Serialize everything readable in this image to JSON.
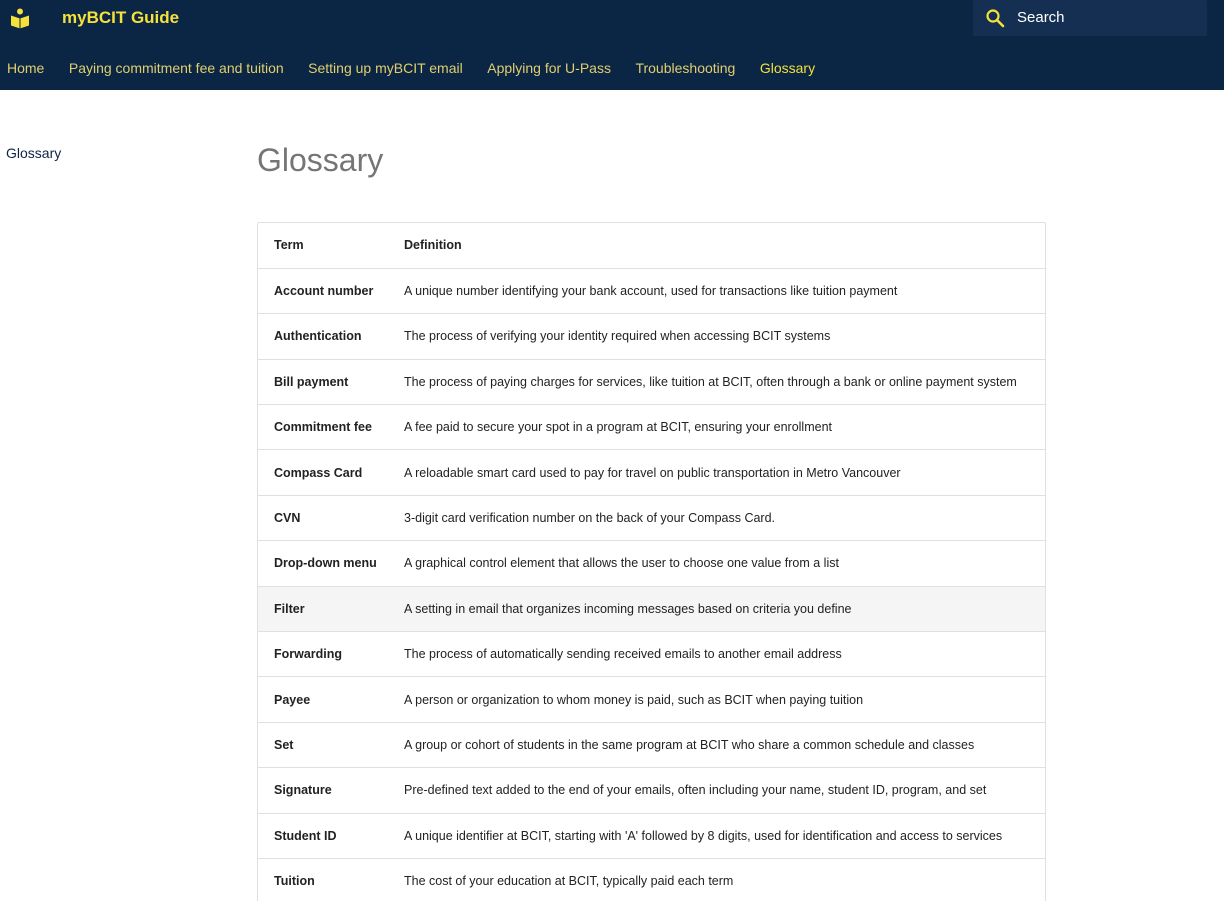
{
  "header": {
    "site_title": "myBCIT Guide",
    "logo_icon": "book-person-icon",
    "search_placeholder": "Search",
    "colors": {
      "background": "#0b2544",
      "accent": "#f5e13c"
    }
  },
  "tabs": [
    {
      "label": "Home",
      "active": false
    },
    {
      "label": "Paying commitment fee and tuition",
      "active": false
    },
    {
      "label": "Setting up myBCIT email",
      "active": false
    },
    {
      "label": "Applying for U-Pass",
      "active": false
    },
    {
      "label": "Troubleshooting",
      "active": false
    },
    {
      "label": "Glossary",
      "active": true
    }
  ],
  "sidebar": {
    "link": "Glossary"
  },
  "main": {
    "title": "Glossary",
    "table": {
      "headers": [
        "Term",
        "Definition"
      ],
      "rows": [
        {
          "term": "Account number",
          "definition": "A unique number identifying your bank account, used for transactions like tuition payment"
        },
        {
          "term": "Authentication",
          "definition": "The process of verifying your identity required when accessing BCIT systems"
        },
        {
          "term": "Bill payment",
          "definition": "The process of paying charges for services, like tuition at BCIT, often through a bank or online payment system"
        },
        {
          "term": "Commitment fee",
          "definition": "A fee paid to secure your spot in a program at BCIT, ensuring your enrollment"
        },
        {
          "term": "Compass Card",
          "definition": "A reloadable smart card used to pay for travel on public transportation in Metro Vancouver"
        },
        {
          "term": "CVN",
          "definition": "3-digit card verification number on the back of your Compass Card."
        },
        {
          "term": "Drop-down menu",
          "definition": "A graphical control element that allows the user to choose one value from a list"
        },
        {
          "term": "Filter",
          "definition": "A setting in email that organizes incoming messages based on criteria you define"
        },
        {
          "term": "Forwarding",
          "definition": "The process of automatically sending received emails to another email address"
        },
        {
          "term": "Payee",
          "definition": "A person or organization to whom money is paid, such as BCIT when paying tuition"
        },
        {
          "term": "Set",
          "definition": "A group or cohort of students in the same program at BCIT who share a common schedule and classes"
        },
        {
          "term": "Signature",
          "definition": "Pre-defined text added to the end of your emails, often including your name, student ID, program, and set"
        },
        {
          "term": "Student ID",
          "definition": "A unique identifier at BCIT, starting with 'A' followed by 8 digits, used for identification and access to services"
        },
        {
          "term": "Tuition",
          "definition": "The cost of your education at BCIT, typically paid each term"
        }
      ]
    }
  }
}
